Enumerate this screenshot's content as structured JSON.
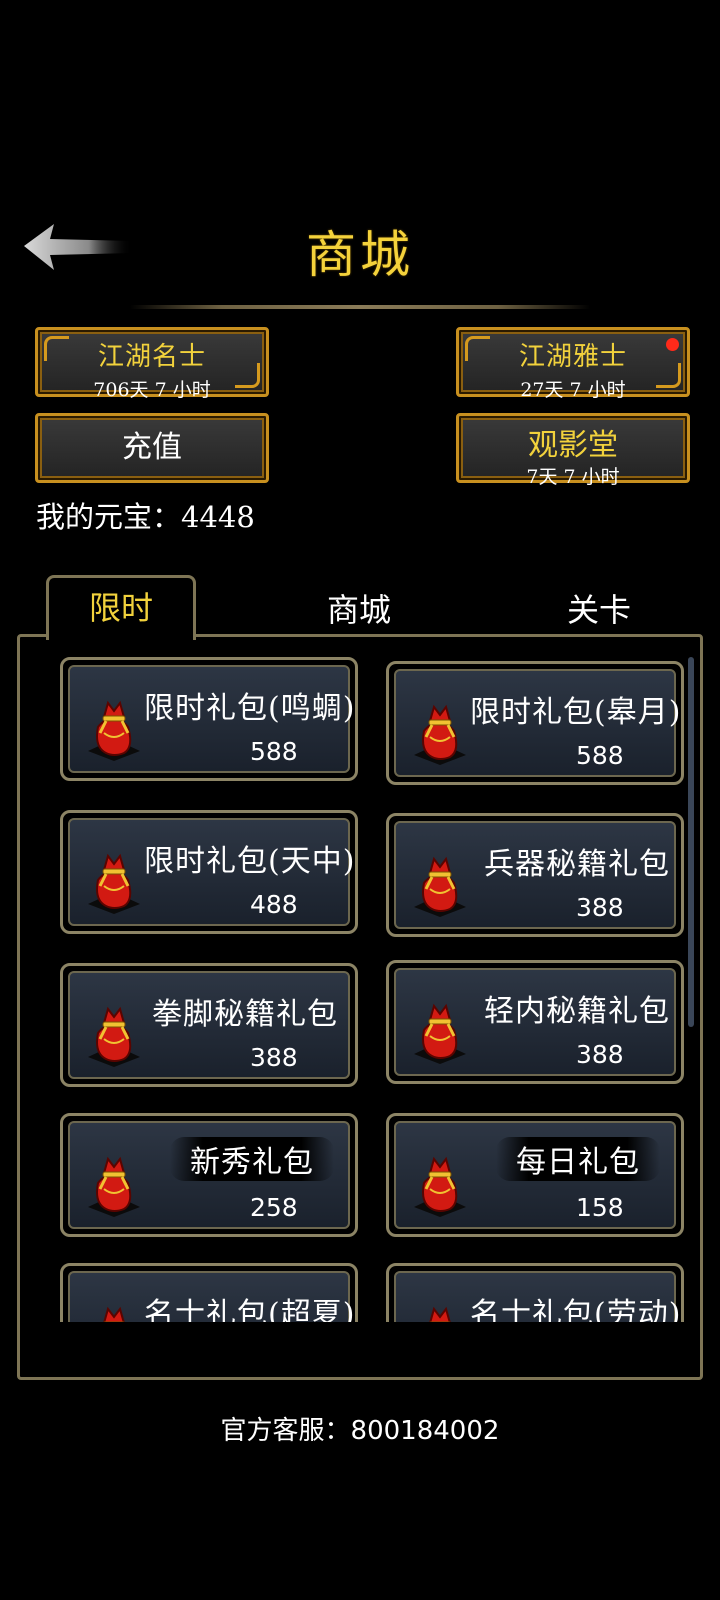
{
  "header": {
    "title": "商城",
    "back_icon": "back-arrow-icon"
  },
  "vip": [
    {
      "name": "江湖名士",
      "remaining": "706天 7 小时"
    },
    {
      "name": "江湖雅士",
      "remaining": "27天 7 小时",
      "has_notification": true
    }
  ],
  "recharge": {
    "label": "充值"
  },
  "theater": {
    "label": "观影堂",
    "remaining": "7天 7 小时"
  },
  "wallet": {
    "text": "我的元宝：4448"
  },
  "tabs": [
    {
      "label": "限时",
      "active": true
    },
    {
      "label": "商城",
      "active": false
    },
    {
      "label": "关卡",
      "active": false
    }
  ],
  "gifts": [
    {
      "name": "限时礼包(鸣蜩)",
      "price": "588"
    },
    {
      "name": "限时礼包(皋月)",
      "price": "588"
    },
    {
      "name": "限时礼包(天中)",
      "price": "488"
    },
    {
      "name": "兵器秘籍礼包",
      "price": "388"
    },
    {
      "name": "拳脚秘籍礼包",
      "price": "388"
    },
    {
      "name": "轻内秘籍礼包",
      "price": "388"
    },
    {
      "name": "新秀礼包",
      "price": "258"
    },
    {
      "name": "每日礼包",
      "price": "158"
    },
    {
      "name": "名士礼包(超夏)",
      "price": ""
    },
    {
      "name": "名士礼包(劳动)",
      "price": ""
    }
  ],
  "footer": {
    "service": "官方客服：800184002"
  },
  "colors": {
    "gold": "#f2d23c",
    "border": "#7e7555",
    "accent": "#c8901f",
    "card_bg": "#2d3644"
  }
}
